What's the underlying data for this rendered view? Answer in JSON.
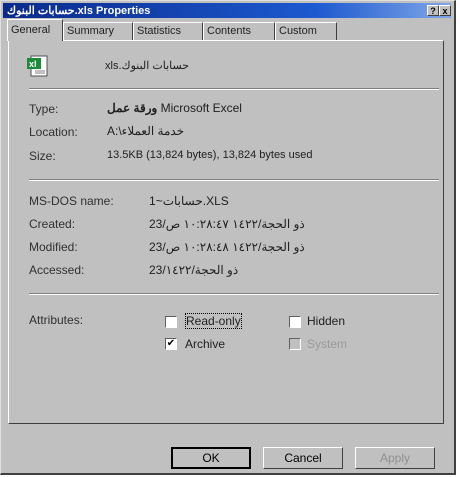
{
  "window": {
    "title": "حسابات البنوك.xls Properties",
    "help_label": "?",
    "close_label": "x"
  },
  "tabs": [
    {
      "label": "General",
      "active": true
    },
    {
      "label": "Summary",
      "active": false
    },
    {
      "label": "Statistics",
      "active": false
    },
    {
      "label": "Contents",
      "active": false
    },
    {
      "label": "Custom",
      "active": false
    }
  ],
  "file": {
    "icon_label": "xl",
    "name": "حسابات البنوك.xls"
  },
  "details": {
    "type_label": "Type:",
    "type_value_ar": "ورقة عمل",
    "type_value_en": "Microsoft Excel",
    "location_label": "Location:",
    "location_value": "A:\\خدمة العملاء",
    "size_label": "Size:",
    "size_value": "13.5KB (13,824 bytes), 13,824 bytes used"
  },
  "dates": {
    "msdos_label": "MS-DOS name:",
    "msdos_value": "حسابات~1.XLS",
    "created_label": "Created:",
    "created_value": "23/ذو الحجة/١٤٢٢ ١٠:٢٨:٤٧ ص",
    "modified_label": "Modified:",
    "modified_value": "23/ذو الحجة/١٤٢٢ ١٠:٢٨:٤٨ ص",
    "accessed_label": "Accessed:",
    "accessed_value": "23/ذو الحجة/١٤٢٢"
  },
  "attributes": {
    "label": "Attributes:",
    "read_only": {
      "label": "Read-only",
      "checked": false
    },
    "hidden": {
      "label": "Hidden",
      "checked": false
    },
    "archive": {
      "label": "Archive",
      "checked": true
    },
    "system": {
      "label": "System",
      "checked": false,
      "disabled": true
    }
  },
  "buttons": {
    "ok": "OK",
    "cancel": "Cancel",
    "apply": "Apply"
  },
  "colors": {
    "title_start": "#0a2a8a",
    "title_end": "#7fa6e8",
    "face": "#c0c0c0"
  }
}
